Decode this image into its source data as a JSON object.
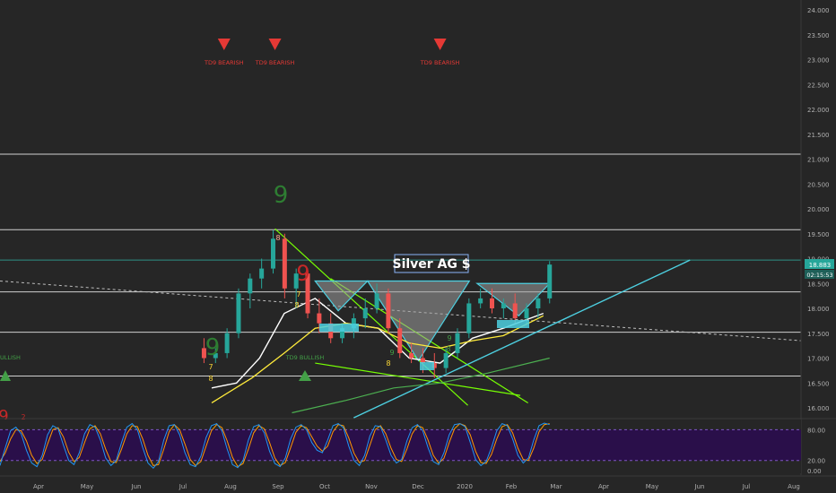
{
  "chart_data": {
    "type": "candlestick-with-indicators",
    "title": "Silver AG $",
    "instrument_label": "Silver AG $",
    "last_price": "18.883",
    "countdown": "02:15:53",
    "price_axis": {
      "range": [
        15.8,
        24.15
      ],
      "ticks": [
        "24.000",
        "23.500",
        "23.000",
        "22.500",
        "22.000",
        "21.500",
        "21.000",
        "20.500",
        "20.000",
        "19.500",
        "19.000",
        "18.500",
        "18.000",
        "17.500",
        "17.000",
        "16.500",
        "16.000"
      ]
    },
    "time_axis": {
      "labels": [
        "Apr",
        "May",
        "Jun",
        "Jul",
        "Aug",
        "Sep",
        "Oct",
        "Nov",
        "Dec",
        "2020",
        "Feb",
        "Mar",
        "Apr",
        "May",
        "Jun",
        "Jul",
        "Aug"
      ]
    },
    "oscillator": {
      "range": [
        -5,
        100
      ],
      "ticks": [
        "80.00",
        "20.00",
        "0.00"
      ],
      "overbought": 80,
      "oversold": 20,
      "k": [
        10,
        45,
        78,
        85,
        72,
        40,
        15,
        8,
        30,
        70,
        88,
        82,
        50,
        20,
        12,
        35,
        72,
        90,
        85,
        60,
        25,
        10,
        20,
        55,
        85,
        92,
        80,
        45,
        15,
        5,
        18,
        60,
        88,
        90,
        70,
        35,
        12,
        8,
        28,
        65,
        88,
        92,
        78,
        42,
        12,
        6,
        20,
        60,
        86,
        90,
        74,
        38,
        14,
        8,
        25,
        62,
        85,
        90,
        80,
        55,
        40,
        35,
        60,
        88,
        92,
        84,
        48,
        20,
        10,
        30,
        68,
        88,
        86,
        60,
        30,
        15,
        22,
        58,
        84,
        90,
        78,
        45,
        18,
        12,
        35,
        70,
        90,
        92,
        86,
        55,
        22,
        10,
        18,
        45,
        78,
        92,
        88,
        62,
        30,
        15,
        25,
        60,
        88,
        93,
        90
      ],
      "d": [
        18,
        35,
        62,
        80,
        78,
        58,
        30,
        14,
        22,
        52,
        80,
        84,
        66,
        36,
        18,
        26,
        55,
        82,
        88,
        72,
        42,
        18,
        16,
        42,
        72,
        88,
        86,
        62,
        30,
        10,
        12,
        42,
        76,
        90,
        80,
        52,
        22,
        10,
        18,
        48,
        78,
        90,
        84,
        58,
        26,
        8,
        14,
        42,
        74,
        88,
        82,
        55,
        25,
        10,
        16,
        45,
        75,
        88,
        84,
        66,
        48,
        38,
        48,
        76,
        90,
        88,
        64,
        34,
        16,
        20,
        50,
        80,
        88,
        72,
        44,
        22,
        18,
        42,
        72,
        88,
        84,
        60,
        30,
        15,
        24,
        55,
        82,
        92,
        88,
        70,
        38,
        16,
        14,
        32,
        62,
        86,
        90,
        74,
        44,
        22,
        20,
        44,
        76,
        90,
        92
      ]
    },
    "horizontal_levels": [
      21.1,
      19.58,
      18.97,
      18.33,
      17.52,
      16.64
    ],
    "annotations": {
      "td9_bearish": [
        {
          "label": "TD9 BEARISH",
          "date": "2019-07-28"
        },
        {
          "label": "TD9 BEARISH",
          "date": "2019-08-30"
        },
        {
          "label": "TD9 BEARISH",
          "date": "2019-12-15"
        }
      ],
      "td9_bullish_label": "TD9 BULLISH",
      "nines": [
        {
          "text": "9",
          "color": "green",
          "date": "2019-09-01"
        },
        {
          "text": "9",
          "color": "red",
          "date": "2019-09-20"
        },
        {
          "text": "9",
          "color": "green",
          "date": "2019-07-30"
        }
      ],
      "setup_digits": [
        {
          "text": "8",
          "color": "yellow",
          "date": "2019-07-31"
        },
        {
          "text": "7",
          "color": "yellow",
          "date": "2019-07-25"
        },
        {
          "text": "8",
          "color": "yellow",
          "date": "2019-09-12"
        },
        {
          "text": "7",
          "color": "yellow",
          "date": "2019-09-10"
        },
        {
          "text": "8",
          "color": "yellow",
          "date": "2019-11-06"
        },
        {
          "text": "9",
          "color": "green",
          "date": "2019-11-07"
        },
        {
          "text": "8",
          "color": "green",
          "date": "2020-01-08"
        },
        {
          "text": "9",
          "color": "green",
          "date": "2020-01-10"
        },
        {
          "text": "8",
          "color": "red",
          "date": "2019-08-28"
        },
        {
          "text": "9",
          "color": "red",
          "date": "2019-03-02"
        },
        {
          "text": "2",
          "color": "red",
          "date": "2019-03-10"
        }
      ]
    },
    "candles": [
      {
        "o": 17.2,
        "h": 17.4,
        "l": 16.9,
        "c": 17.0
      },
      {
        "o": 17.0,
        "h": 17.2,
        "l": 16.9,
        "c": 17.1
      },
      {
        "o": 17.1,
        "h": 17.6,
        "l": 17.0,
        "c": 17.5
      },
      {
        "o": 17.5,
        "h": 18.4,
        "l": 17.4,
        "c": 18.3
      },
      {
        "o": 18.3,
        "h": 18.7,
        "l": 18.0,
        "c": 18.6
      },
      {
        "o": 18.6,
        "h": 19.0,
        "l": 18.4,
        "c": 18.8
      },
      {
        "o": 18.8,
        "h": 19.57,
        "l": 18.7,
        "c": 19.4
      },
      {
        "o": 19.4,
        "h": 19.5,
        "l": 18.2,
        "c": 18.4
      },
      {
        "o": 18.4,
        "h": 18.8,
        "l": 18.0,
        "c": 18.7
      },
      {
        "o": 18.7,
        "h": 18.8,
        "l": 17.8,
        "c": 17.9
      },
      {
        "o": 17.9,
        "h": 18.2,
        "l": 17.5,
        "c": 17.7
      },
      {
        "o": 17.7,
        "h": 17.9,
        "l": 17.3,
        "c": 17.4
      },
      {
        "o": 17.4,
        "h": 17.7,
        "l": 17.3,
        "c": 17.6
      },
      {
        "o": 17.6,
        "h": 17.9,
        "l": 17.4,
        "c": 17.8
      },
      {
        "o": 17.8,
        "h": 18.2,
        "l": 17.6,
        "c": 18.0
      },
      {
        "o": 18.0,
        "h": 18.5,
        "l": 17.9,
        "c": 18.3
      },
      {
        "o": 18.3,
        "h": 18.4,
        "l": 17.5,
        "c": 17.6
      },
      {
        "o": 17.6,
        "h": 17.8,
        "l": 17.0,
        "c": 17.1
      },
      {
        "o": 17.1,
        "h": 17.3,
        "l": 16.9,
        "c": 17.0
      },
      {
        "o": 17.0,
        "h": 17.2,
        "l": 16.7,
        "c": 16.9
      },
      {
        "o": 16.9,
        "h": 17.1,
        "l": 16.6,
        "c": 16.8
      },
      {
        "o": 16.8,
        "h": 17.2,
        "l": 16.7,
        "c": 17.1
      },
      {
        "o": 17.1,
        "h": 17.6,
        "l": 17.0,
        "c": 17.5
      },
      {
        "o": 17.5,
        "h": 18.2,
        "l": 17.4,
        "c": 18.1
      },
      {
        "o": 18.1,
        "h": 18.4,
        "l": 18.0,
        "c": 18.2
      },
      {
        "o": 18.2,
        "h": 18.4,
        "l": 17.9,
        "c": 18.0
      },
      {
        "o": 18.0,
        "h": 18.2,
        "l": 17.8,
        "c": 18.1
      },
      {
        "o": 18.1,
        "h": 18.3,
        "l": 17.7,
        "c": 17.8
      },
      {
        "o": 17.8,
        "h": 18.1,
        "l": 17.7,
        "c": 18.0
      },
      {
        "o": 18.0,
        "h": 18.3,
        "l": 17.8,
        "c": 18.2
      },
      {
        "o": 18.2,
        "h": 18.95,
        "l": 18.1,
        "c": 18.88
      }
    ]
  }
}
